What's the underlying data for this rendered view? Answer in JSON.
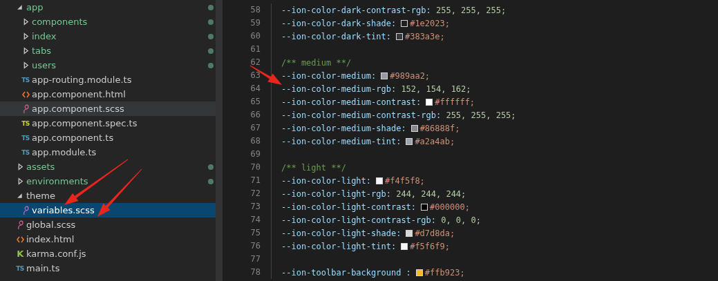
{
  "explorer": {
    "items": [
      {
        "name": "app",
        "kind": "folder",
        "expanded": true,
        "untracked": true,
        "selected": false,
        "hovered": false,
        "children": [
          {
            "name": "components",
            "kind": "folder",
            "expanded": false,
            "untracked": true,
            "selected": false,
            "hovered": false
          },
          {
            "name": "index",
            "kind": "folder",
            "expanded": false,
            "untracked": true,
            "selected": false,
            "hovered": false
          },
          {
            "name": "tabs",
            "kind": "folder",
            "expanded": false,
            "untracked": true,
            "selected": false,
            "hovered": false
          },
          {
            "name": "users",
            "kind": "folder",
            "expanded": false,
            "untracked": true,
            "selected": false,
            "hovered": false
          },
          {
            "name": "app-routing.module.ts",
            "kind": "ts",
            "badge": "TS",
            "selected": false,
            "hovered": false
          },
          {
            "name": "app.component.html",
            "kind": "html",
            "selected": false,
            "hovered": false
          },
          {
            "name": "app.component.scss",
            "kind": "scss",
            "selected": false,
            "hovered": true
          },
          {
            "name": "app.component.spec.ts",
            "kind": "spec",
            "badge": "TS",
            "selected": false,
            "hovered": false
          },
          {
            "name": "app.component.ts",
            "kind": "ts",
            "badge": "TS",
            "selected": false,
            "hovered": false
          },
          {
            "name": "app.module.ts",
            "kind": "ts",
            "badge": "TS",
            "selected": false,
            "hovered": false
          }
        ]
      },
      {
        "name": "assets",
        "kind": "folder",
        "expanded": false,
        "untracked": true,
        "selected": false,
        "hovered": false
      },
      {
        "name": "environments",
        "kind": "folder",
        "expanded": false,
        "untracked": true,
        "selected": false,
        "hovered": false
      },
      {
        "name": "theme",
        "kind": "folder",
        "expanded": true,
        "untracked": false,
        "selected": false,
        "hovered": false,
        "children": [
          {
            "name": "variables.scss",
            "kind": "scss",
            "selected": true,
            "hovered": false
          }
        ]
      },
      {
        "name": "global.scss",
        "kind": "scss",
        "selected": false,
        "hovered": false
      },
      {
        "name": "index.html",
        "kind": "html",
        "selected": false,
        "hovered": false
      },
      {
        "name": "karma.conf.js",
        "kind": "karma",
        "badge": "K",
        "selected": false,
        "hovered": false
      },
      {
        "name": "main.ts",
        "kind": "ts",
        "badge": "TS",
        "selected": false,
        "hovered": false
      }
    ]
  },
  "editor": {
    "lines": [
      {
        "number": "58",
        "kind": "numbers",
        "property": "--ion-color-dark-contrast-rgb:",
        "value": "255, 255, 255;"
      },
      {
        "number": "59",
        "kind": "color",
        "property": "--ion-color-dark-shade:",
        "value": "#1e2023;",
        "color": "#1e2023"
      },
      {
        "number": "60",
        "kind": "color",
        "property": "--ion-color-dark-tint:",
        "value": "#383a3e;",
        "color": "#383a3e"
      },
      {
        "number": "61",
        "kind": "blank"
      },
      {
        "number": "62",
        "kind": "comment",
        "text": "/** medium **/"
      },
      {
        "number": "63",
        "kind": "color",
        "property": "--ion-color-medium:",
        "value": "#989aa2;",
        "color": "#989aa2"
      },
      {
        "number": "64",
        "kind": "numbers",
        "property": "--ion-color-medium-rgb:",
        "value": "152, 154, 162;"
      },
      {
        "number": "65",
        "kind": "color",
        "property": "--ion-color-medium-contrast:",
        "value": "#ffffff;",
        "color": "#ffffff"
      },
      {
        "number": "66",
        "kind": "numbers",
        "property": "--ion-color-medium-contrast-rgb:",
        "value": "255, 255, 255;"
      },
      {
        "number": "67",
        "kind": "color",
        "property": "--ion-color-medium-shade:",
        "value": "#86888f;",
        "color": "#86888f"
      },
      {
        "number": "68",
        "kind": "color",
        "property": "--ion-color-medium-tint:",
        "value": "#a2a4ab;",
        "color": "#a2a4ab"
      },
      {
        "number": "69",
        "kind": "blank"
      },
      {
        "number": "70",
        "kind": "comment",
        "text": "/** light **/"
      },
      {
        "number": "71",
        "kind": "color",
        "property": "--ion-color-light:",
        "value": "#f4f5f8;",
        "color": "#f4f5f8"
      },
      {
        "number": "72",
        "kind": "numbers",
        "property": "--ion-color-light-rgb:",
        "value": "244, 244, 244;"
      },
      {
        "number": "73",
        "kind": "color",
        "property": "--ion-color-light-contrast:",
        "value": "#000000;",
        "color": "#000000"
      },
      {
        "number": "74",
        "kind": "numbers",
        "property": "--ion-color-light-contrast-rgb:",
        "value": "0, 0, 0;"
      },
      {
        "number": "75",
        "kind": "color",
        "property": "--ion-color-light-shade:",
        "value": "#d7d8da;",
        "color": "#d7d8da"
      },
      {
        "number": "76",
        "kind": "color",
        "property": "--ion-color-light-tint:",
        "value": "#f5f6f9;",
        "color": "#f5f6f9"
      },
      {
        "number": "77",
        "kind": "blank"
      },
      {
        "number": "78",
        "kind": "color",
        "property": "--ion-toolbar-background :",
        "value": "#ffb923;",
        "color": "#ffb923"
      }
    ]
  }
}
